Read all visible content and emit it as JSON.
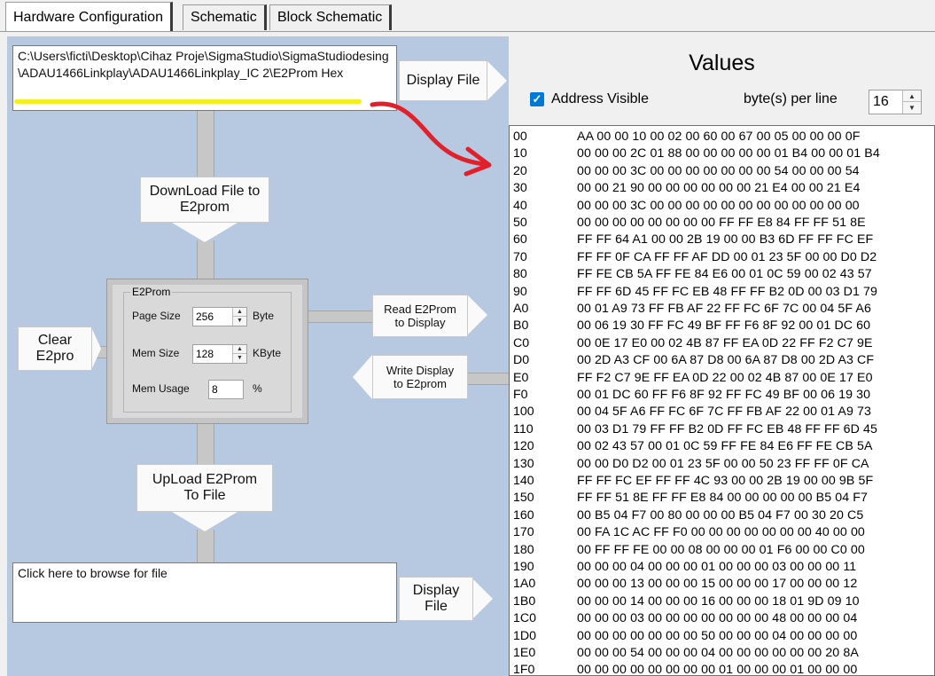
{
  "tabs": [
    {
      "label": "Hardware Configuration"
    },
    {
      "label": "Schematic"
    },
    {
      "label": "Block Schematic"
    }
  ],
  "top_file": {
    "path": "C:\\Users\\ficti\\Desktop\\Cihaz Proje\\SigmaStudio\\SigmaStudiodesing\\ADAU1466Linkplay\\ADAU1466Linkplay_IC 2\\E2Prom Hex",
    "display_button": "Display File"
  },
  "download_button": "DownLoad File to E2prom",
  "upload_button": "UpLoad E2Prom To File",
  "clear_button": "Clear E2pro",
  "read_button": "Read E2Prom to Display",
  "write_button": "Write Display to E2prom",
  "e2prom": {
    "legend": "E2Prom",
    "page_size_label": "Page Size",
    "page_size": "256",
    "page_size_unit": "Byte",
    "mem_size_label": "Mem Size",
    "mem_size": "128",
    "mem_size_unit": "KByte",
    "mem_usage_label": "Mem Usage",
    "mem_usage": "8",
    "mem_usage_unit": "%"
  },
  "bottom_file": {
    "placeholder": "Click here to browse for file",
    "display_button": "Display File"
  },
  "values": {
    "title": "Values",
    "address_visible_label": "Address Visible",
    "address_visible": true,
    "bytes_per_line_label": "byte(s) per line",
    "bytes_per_line": "16",
    "rows": [
      {
        "addr": "00",
        "bytes": "AA 00 00 10 00 02 00 60 00 67 00 05 00 00 00 0F"
      },
      {
        "addr": "10",
        "bytes": "00 00 00 2C 01 88 00 00 00 00 00 01 B4 00 00 01 B4"
      },
      {
        "addr": "20",
        "bytes": "00 00 00 3C 00 00 00 00 00 00 00 54 00 00 00 54"
      },
      {
        "addr": "30",
        "bytes": "00 00 21 90 00 00 00 00 00 00 21 E4 00 00 21 E4"
      },
      {
        "addr": "40",
        "bytes": "00 00 00 3C 00 00 00 00 00 00 00 00 00 00 00 00"
      },
      {
        "addr": "50",
        "bytes": "00 00 00 00 00 00 00 00 FF FF E8 84 FF FF 51 8E"
      },
      {
        "addr": "60",
        "bytes": "FF FF 64 A1 00 00 2B 19 00 00 B3 6D FF FF FC EF"
      },
      {
        "addr": "70",
        "bytes": "FF FF 0F CA FF FF AF DD 00 01 23 5F 00 00 D0 D2"
      },
      {
        "addr": "80",
        "bytes": "FF FE CB 5A FF FE 84 E6 00 01 0C 59 00 02 43 57"
      },
      {
        "addr": "90",
        "bytes": "FF FF 6D 45 FF FC EB 48 FF FF B2 0D 00 03 D1 79"
      },
      {
        "addr": "A0",
        "bytes": "00 01 A9 73 FF FB AF 22 FF FC 6F 7C 00 04 5F A6"
      },
      {
        "addr": "B0",
        "bytes": "00 06 19 30 FF FC 49 BF FF F6 8F 92 00 01 DC 60"
      },
      {
        "addr": "C0",
        "bytes": "00 0E 17 E0 00 02 4B 87 FF EA 0D 22 FF F2 C7 9E"
      },
      {
        "addr": "D0",
        "bytes": "00 2D A3 CF 00 6A 87 D8 00 6A 87 D8 00 2D A3 CF"
      },
      {
        "addr": "E0",
        "bytes": "FF F2 C7 9E FF EA 0D 22 00 02 4B 87 00 0E 17 E0"
      },
      {
        "addr": "F0",
        "bytes": "00 01 DC 60 FF F6 8F 92 FF FC 49 BF 00 06 19 30"
      },
      {
        "addr": "100",
        "bytes": "00 04 5F A6 FF FC 6F 7C FF FB AF 22 00 01 A9 73"
      },
      {
        "addr": "110",
        "bytes": "00 03 D1 79 FF FF B2 0D FF FC EB 48 FF FF 6D 45"
      },
      {
        "addr": "120",
        "bytes": "00 02 43 57 00 01 0C 59 FF FE 84 E6 FF FE CB 5A"
      },
      {
        "addr": "130",
        "bytes": "00 00 D0 D2 00 01 23 5F 00 00 50 23 FF FF 0F CA"
      },
      {
        "addr": "140",
        "bytes": "FF FF FC EF FF FF 4C 93 00 00 2B 19 00 00 9B 5F"
      },
      {
        "addr": "150",
        "bytes": "FF FF 51 8E FF FF E8 84 00 00 00 00 00 B5 04 F7"
      },
      {
        "addr": "160",
        "bytes": "00 B5 04 F7 00 80 00 00 00 B5 04 F7 00 30 20 C5"
      },
      {
        "addr": "170",
        "bytes": "00 FA 1C AC FF F0 00 00 00 00 00 00 00 40 00 00"
      },
      {
        "addr": "180",
        "bytes": "00 FF FF FE 00 00 08 00 00 00 01 F6 00 00 C0 00"
      },
      {
        "addr": "190",
        "bytes": "00 00 00 04 00 00 00 01 00 00 00 03 00 00 00 11"
      },
      {
        "addr": "1A0",
        "bytes": "00 00 00 13 00 00 00 15 00 00 00 17 00 00 00 12"
      },
      {
        "addr": "1B0",
        "bytes": "00 00 00 14 00 00 00 16 00 00 00 18 01 9D 09 10"
      },
      {
        "addr": "1C0",
        "bytes": "00 00 00 03 00 00 00 00 00 00 00 48 00 00 00 04"
      },
      {
        "addr": "1D0",
        "bytes": "00 00 00 00 00 00 00 50 00 00 00 04 00 00 00 00"
      },
      {
        "addr": "1E0",
        "bytes": "00 00 00 54 00 00 00 04 00 00 00 00 00 00 20 8A"
      },
      {
        "addr": "1F0",
        "bytes": "00 00 00 00 00 00 00 00 01 00 00 00 01 00 00 00"
      }
    ]
  },
  "colors": {
    "panel_blue": "#b7c9e1",
    "highlight": "#f4ef20",
    "annotation_red": "#e0202a",
    "checkbox_blue": "#0078d7"
  }
}
